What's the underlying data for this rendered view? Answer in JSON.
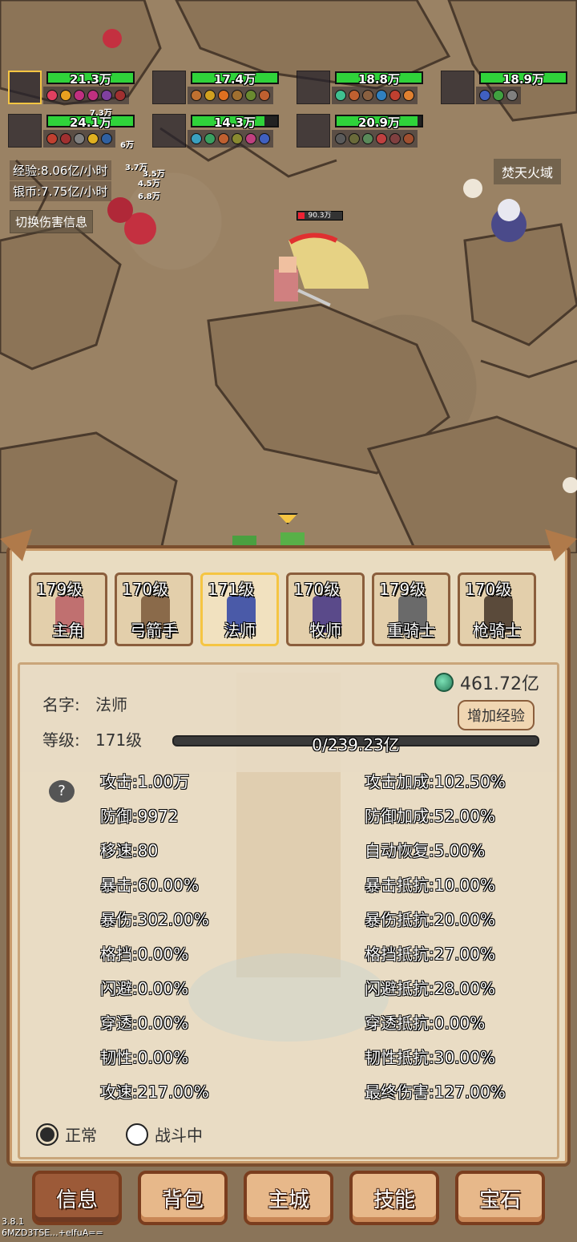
{
  "field": {
    "party": [
      {
        "hp": "21.3万",
        "hp_pct": 1.0,
        "selected": true
      },
      {
        "hp": "17.4万",
        "hp_pct": 1.0
      },
      {
        "hp": "18.8万",
        "hp_pct": 1.0
      },
      {
        "hp": "18.9万",
        "hp_pct": 1.0
      },
      {
        "hp": "24.1万",
        "hp_pct": 1.0
      },
      {
        "hp": "14.3万",
        "hp_pct": 0.85
      },
      {
        "hp": "20.9万",
        "hp_pct": 0.95
      }
    ],
    "exp_rate": "经验:8.06亿/小时",
    "silver_rate": "银币:7.75亿/小时",
    "toggle_damage_label": "切换伤害信息",
    "zone_name": "焚天火域",
    "enemy_hp": "90.3万",
    "float_numbers": [
      "3.7万",
      "4.5万",
      "6.8万",
      "6万",
      "7.3万",
      "3.5万"
    ]
  },
  "heroes": [
    {
      "level": "179级",
      "name": "主角",
      "color": "#c07070"
    },
    {
      "level": "170级",
      "name": "弓箭手",
      "color": "#8a6a4a"
    },
    {
      "level": "171级",
      "name": "法师",
      "color": "#4a5aa8",
      "selected": true
    },
    {
      "level": "170级",
      "name": "牧师",
      "color": "#5a4a8a"
    },
    {
      "level": "179级",
      "name": "重骑士",
      "color": "#6a6a6a"
    },
    {
      "level": "170级",
      "name": "枪骑士",
      "color": "#5a4a3a"
    }
  ],
  "info": {
    "gem_amount": "461.72亿",
    "add_exp_label": "增加经验",
    "name_label": "名字:",
    "name_value": "法师",
    "level_label": "等级:",
    "level_value": "171级",
    "exp_text": "0/239.23亿",
    "exp_pct": 0.0
  },
  "stats_left": [
    "攻击:1.00万",
    "防御:9972",
    "移速:80",
    "暴击:60.00%",
    "暴伤:302.00%",
    "格挡:0.00%",
    "闪避:0.00%",
    "穿透:0.00%",
    "韧性:0.00%",
    "攻速:217.00%"
  ],
  "stats_right": [
    "攻击加成:102.50%",
    "防御加成:52.00%",
    "自动恢复:5.00%",
    "暴击抵抗:10.00%",
    "暴伤抵抗:20.00%",
    "格挡抵抗:27.00%",
    "闪避抵抗:28.00%",
    "穿透抵抗:0.00%",
    "韧性抵抗:30.00%",
    "最终伤害:127.00%"
  ],
  "help_label": "?",
  "legend": {
    "normal": "正常",
    "combat": "战斗中"
  },
  "nav": [
    "信息",
    "背包",
    "主城",
    "技能",
    "宝石"
  ],
  "version": "3.8.1",
  "device_id": "6MZD3TSE...+eIfuA=="
}
